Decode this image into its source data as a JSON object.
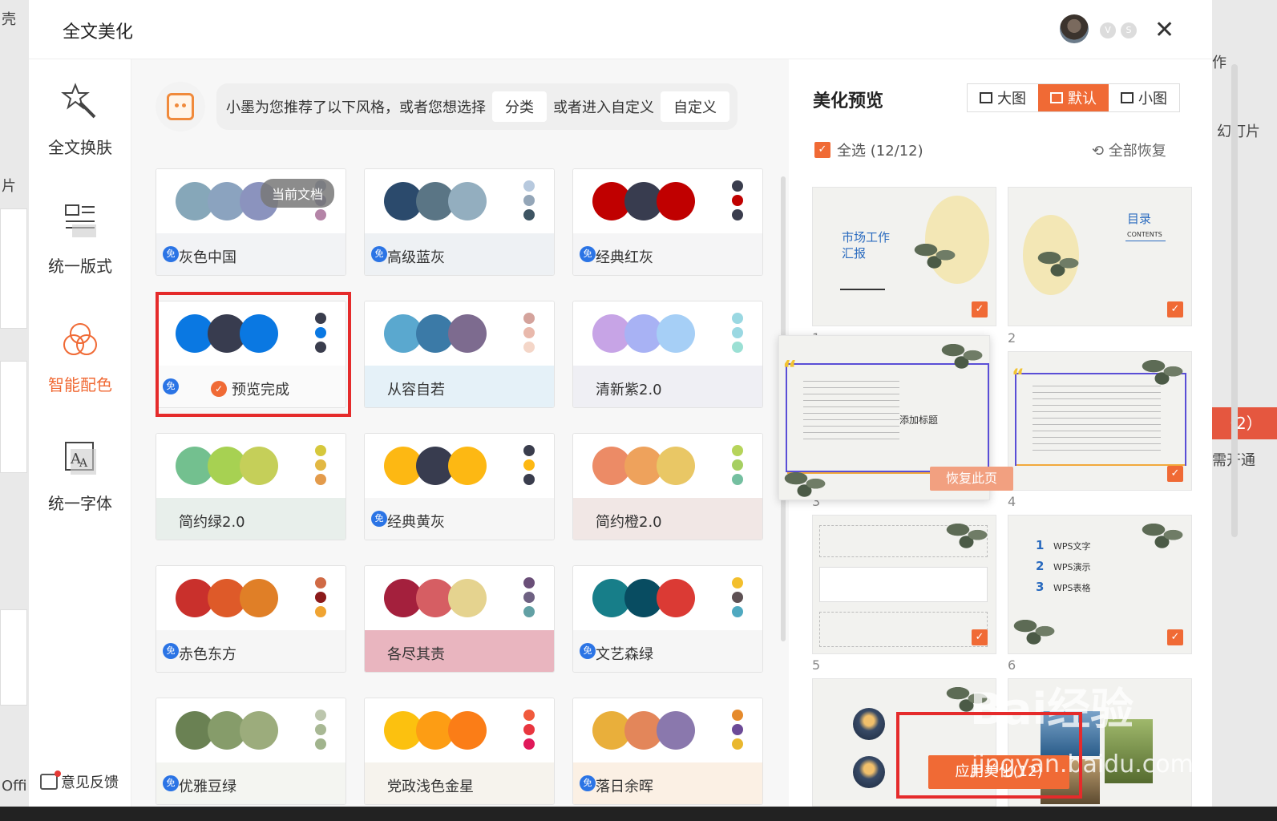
{
  "window": {
    "title": "全文美化",
    "close_glyph": "✕"
  },
  "background": {
    "left_frag_top": "壳",
    "left_frag_mid": "片",
    "left_frag_bottom": "Offi",
    "right_frag_top": "作",
    "right_frag_mid": "幻灯片",
    "right_badge": "（2）",
    "right_frag_low": "需开通"
  },
  "nav": [
    {
      "label": "全文换肤",
      "icon": "magic-wand-icon"
    },
    {
      "label": "统一版式",
      "icon": "layout-icon"
    },
    {
      "label": "智能配色",
      "icon": "color-circles-icon",
      "active": true
    },
    {
      "label": "统一字体",
      "icon": "font-icon"
    }
  ],
  "feedback": "意见反馈",
  "recommend": {
    "text1": "小墨为您推荐了以下风格，或者您想选择",
    "chip1": "分类",
    "text2": "或者进入自定义",
    "chip2": "自定义"
  },
  "free_glyph": "免",
  "current_doc": "当前文档",
  "preview_done": "预览完成",
  "schemes": [
    {
      "name": "灰色中国",
      "free": true,
      "circles": [
        "#86a7b9",
        "#8ba3bf",
        "#8b93be"
      ],
      "dots": [
        "#8a99b8",
        "#7c74a5",
        "#b484a7"
      ],
      "bottom": "#f2f3f5",
      "current": true
    },
    {
      "name": "高级蓝灰",
      "free": true,
      "circles": [
        "#2b4a6c",
        "#5a7585",
        "#93aebf"
      ],
      "dots": [
        "#b7c9de",
        "#94a6b8",
        "#3e5563"
      ],
      "bottom": "#eef1f4"
    },
    {
      "name": "经典红灰",
      "free": true,
      "circles": [
        "#c00000",
        "#383c4f",
        "#c00000"
      ],
      "dots": [
        "#3a3d4d",
        "#c00000",
        "#3a3d4d"
      ],
      "bottom": "#f5f5f6"
    },
    {
      "name": "",
      "free": true,
      "circles": [
        "#0a78e2",
        "#383c4f",
        "#0a78e2"
      ],
      "dots": [
        "#3a3d4d",
        "#0a78e2",
        "#3a3d4d"
      ],
      "bottom": "#fafafa",
      "done": true
    },
    {
      "name": "从容自若",
      "free": false,
      "circles": [
        "#5aa8cf",
        "#3b7aa7",
        "#7d6b8f"
      ],
      "dots": [
        "#d4a39c",
        "#e9b9ac",
        "#f4d6c8"
      ],
      "bottom": "#e5f1f8"
    },
    {
      "name": "清新紫2.0",
      "free": false,
      "circles": [
        "#c7a4e6",
        "#a8b2f4",
        "#a6cff6"
      ],
      "dots": [
        "#9ad8e2",
        "#9ad8e2",
        "#9be0d4"
      ],
      "bottom": "#efeff4"
    },
    {
      "name": "简约绿2.0",
      "free": false,
      "circles": [
        "#73c08f",
        "#a7d152",
        "#c5cf59"
      ],
      "dots": [
        "#d6c83c",
        "#e2b843",
        "#e39b4b"
      ],
      "bottom": "#e8efeb"
    },
    {
      "name": "经典黄灰",
      "free": true,
      "circles": [
        "#fdb813",
        "#383c4f",
        "#fdb813"
      ],
      "dots": [
        "#3a3d4d",
        "#fdb813",
        "#3a3d4d"
      ],
      "bottom": "#f6f6f6"
    },
    {
      "name": "简约橙2.0",
      "free": false,
      "circles": [
        "#ec8b66",
        "#eea25c",
        "#e9c765"
      ],
      "dots": [
        "#b6d45a",
        "#a6cf62",
        "#74bfa0"
      ],
      "bottom": "#f1e7e5"
    },
    {
      "name": "赤色东方",
      "free": true,
      "circles": [
        "#c9302c",
        "#de5a29",
        "#e07f27"
      ],
      "dots": [
        "#d06a45",
        "#8b1a1a",
        "#f0a432"
      ],
      "bottom": "#f6f6f6"
    },
    {
      "name": "各尽其责",
      "free": false,
      "circles": [
        "#a4203d",
        "#d65e63",
        "#e5d38f"
      ],
      "dots": [
        "#6a4f78",
        "#6e6182",
        "#62a0a4"
      ],
      "bottom": "#e9b5bf"
    },
    {
      "name": "文艺森绿",
      "free": true,
      "circles": [
        "#177e89",
        "#084c61",
        "#db3a34"
      ],
      "dots": [
        "#f3bf2c",
        "#5e5154",
        "#4fa9c0"
      ],
      "bottom": "#f6f6f6"
    },
    {
      "name": "优雅豆绿",
      "free": true,
      "circles": [
        "#6a8153",
        "#869c6a",
        "#9cac7c"
      ],
      "dots": [
        "#bcc6ad",
        "#a8b894",
        "#a1b48d"
      ],
      "bottom": "#f4f5f1"
    },
    {
      "name": "党政浅色金星",
      "free": false,
      "circles": [
        "#fcc10f",
        "#fd9d14",
        "#fb7d17"
      ],
      "dots": [
        "#f05a3c",
        "#e8363f",
        "#e0195a"
      ],
      "bottom": "#f6f3ed"
    },
    {
      "name": "落日余晖",
      "free": true,
      "circles": [
        "#e9af3b",
        "#e3865a",
        "#8a78ad"
      ],
      "dots": [
        "#e58a2c",
        "#6c4a97",
        "#e9b72e"
      ],
      "bottom": "#fbf0e4"
    }
  ],
  "preview": {
    "title": "美化预览",
    "views": [
      "大图",
      "默认",
      "小图"
    ],
    "active_view": "默认",
    "select_all": "全选 (12/12)",
    "check_glyph": "✓",
    "restore_all": "全部恢复",
    "restore_page": "恢复此页",
    "apply": "应用美化(12)",
    "slide_nums": [
      "1",
      "2",
      "3",
      "4",
      "5",
      "6"
    ],
    "s1_title": "市场工作汇报",
    "s2_title": "目录",
    "s2_sub": "CONTENTS",
    "s3_add": "添加标题",
    "s6_items": [
      "WPS文字",
      "WPS演示",
      "WPS表格"
    ],
    "s6_nums": [
      "1",
      "2",
      "3"
    ]
  },
  "watermark": {
    "line1": "Bai经验",
    "line2": "jingyan.baidu.com"
  }
}
